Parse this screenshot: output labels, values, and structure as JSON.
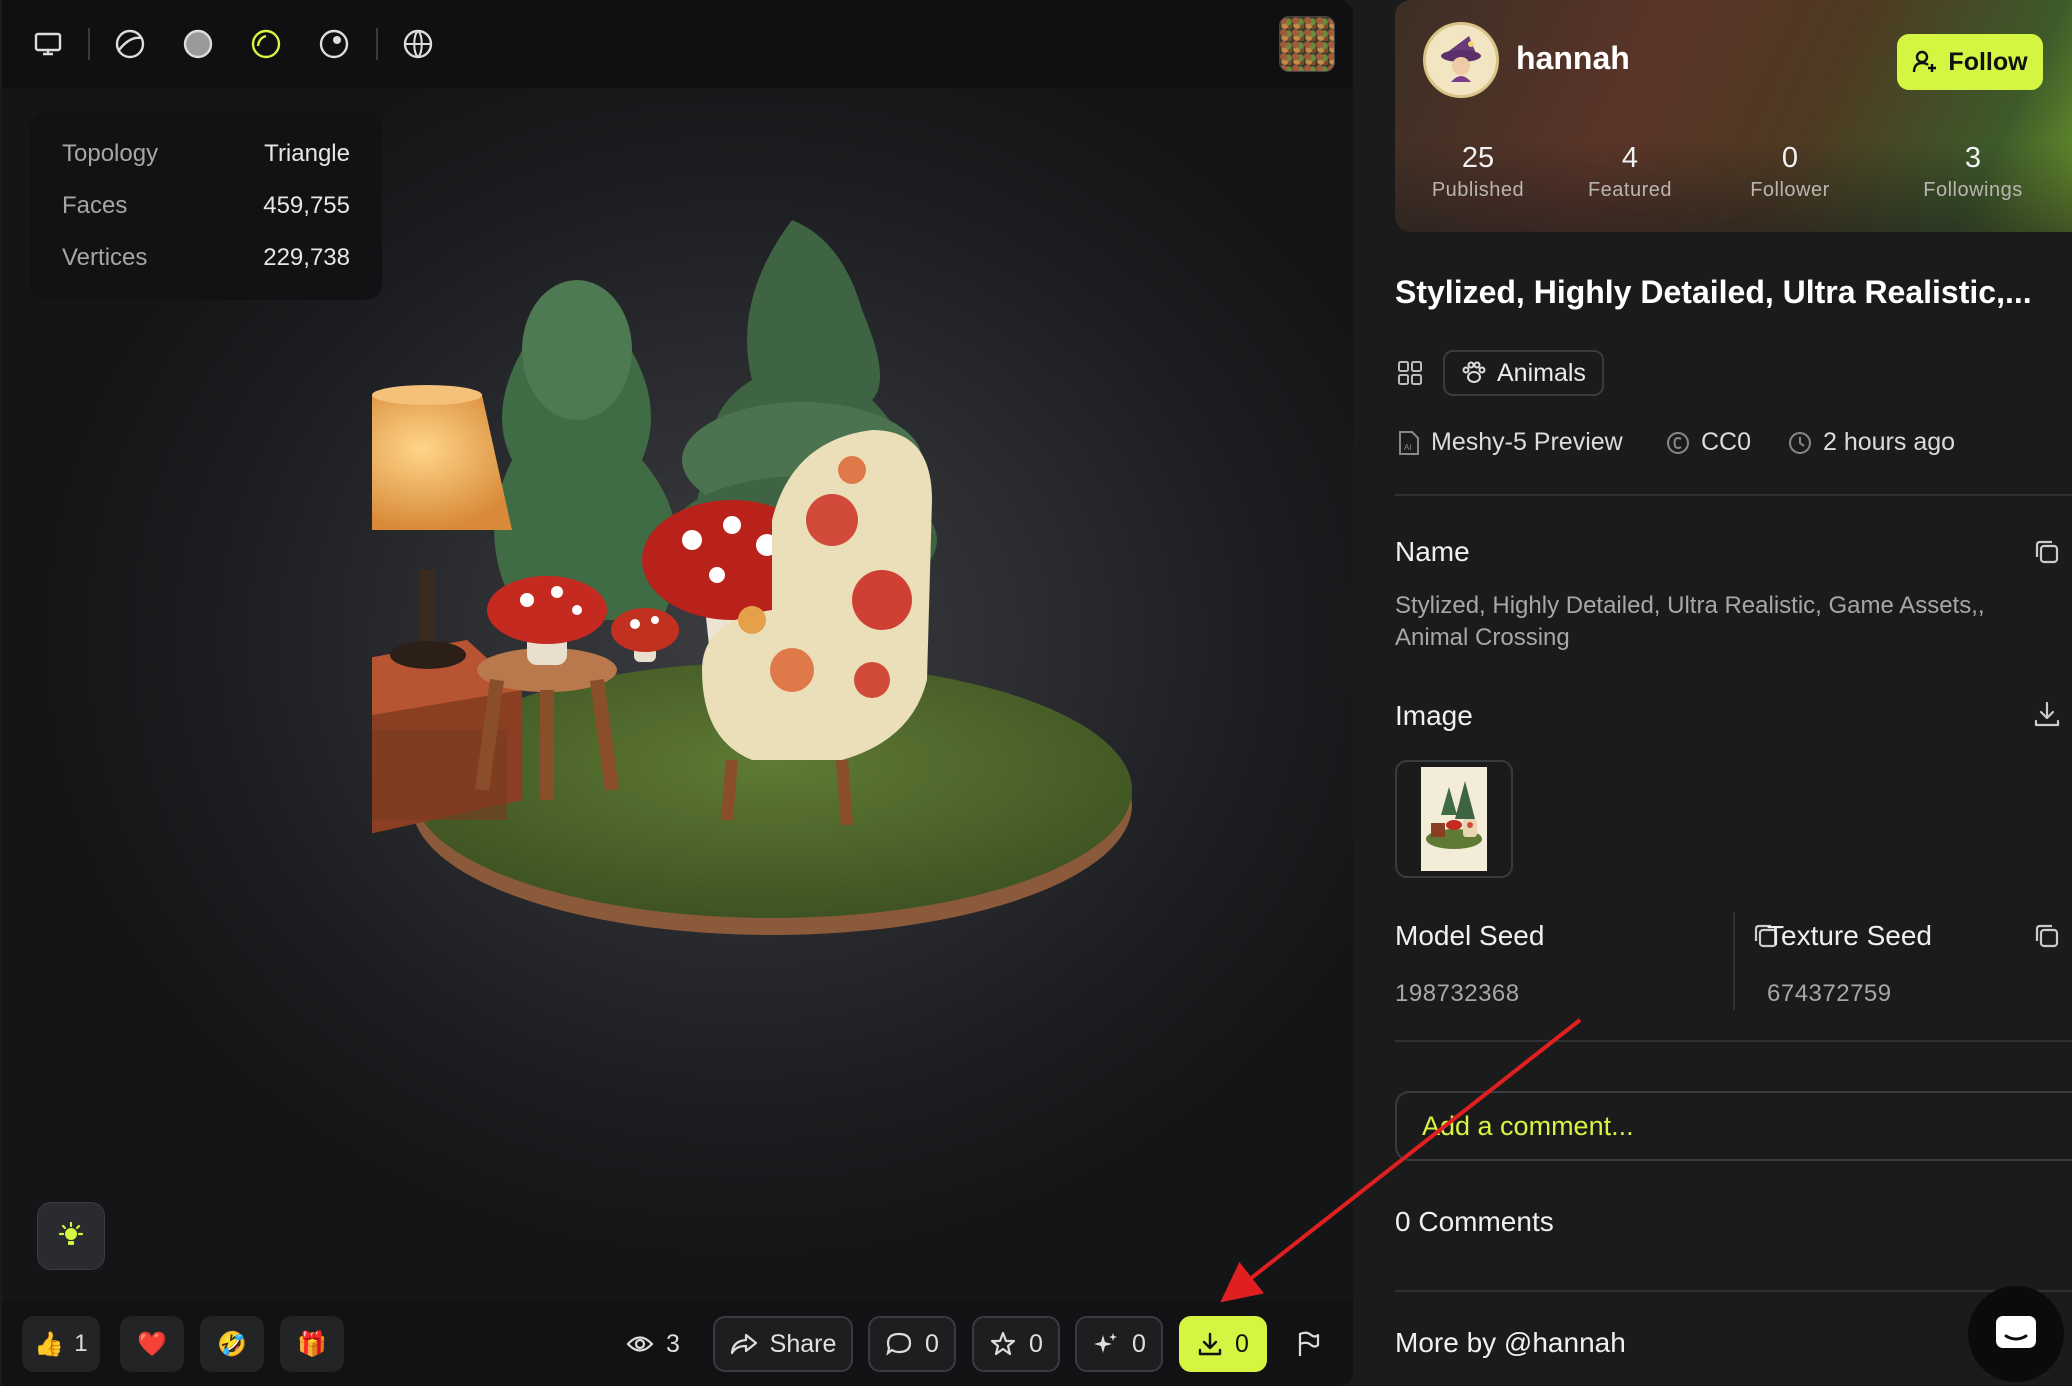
{
  "viewer": {
    "toolbar": {
      "icons": [
        "monitor-icon",
        "wireframe-sphere-icon",
        "solid-sphere-icon",
        "outline-sphere-icon",
        "matcap-sphere-icon",
        "globe-icon"
      ]
    },
    "stats": [
      {
        "key": "Topology",
        "value": "Triangle"
      },
      {
        "key": "Faces",
        "value": "459,755"
      },
      {
        "key": "Vertices",
        "value": "229,738"
      }
    ],
    "reactions": [
      {
        "emoji": "👍",
        "count": "1"
      },
      {
        "emoji": "❤️",
        "count": ""
      },
      {
        "emoji": "🤣",
        "count": ""
      },
      {
        "emoji": "🎁",
        "count": ""
      }
    ],
    "actions": {
      "views": "3",
      "share_label": "Share",
      "comments": "0",
      "stars": "0",
      "remix": "0",
      "downloads": "0"
    }
  },
  "profile": {
    "username": "hannah",
    "follow_label": "Follow",
    "stats": [
      {
        "number": "25",
        "label": "Published"
      },
      {
        "number": "4",
        "label": "Featured"
      },
      {
        "number": "0",
        "label": "Follower"
      },
      {
        "number": "3",
        "label": "Followings"
      }
    ]
  },
  "model": {
    "title": "Stylized, Highly Detailed, Ultra Realistic,...",
    "category": "Animals",
    "generator": "Meshy-5 Preview",
    "license": "CC0",
    "time": "2 hours ago",
    "name_label": "Name",
    "name_value": "Stylized, Highly Detailed, Ultra Realistic, Game Assets,, Animal Crossing",
    "image_label": "Image",
    "model_seed_label": "Model Seed",
    "model_seed": "198732368",
    "texture_seed_label": "Texture Seed",
    "texture_seed": "674372759"
  },
  "comments": {
    "placeholder": "Add a comment...",
    "count_label": "0 Comments"
  },
  "more_by": "More by @hannah",
  "colors": {
    "accent": "#d4f542",
    "annotation_arrow": "#e02020"
  }
}
